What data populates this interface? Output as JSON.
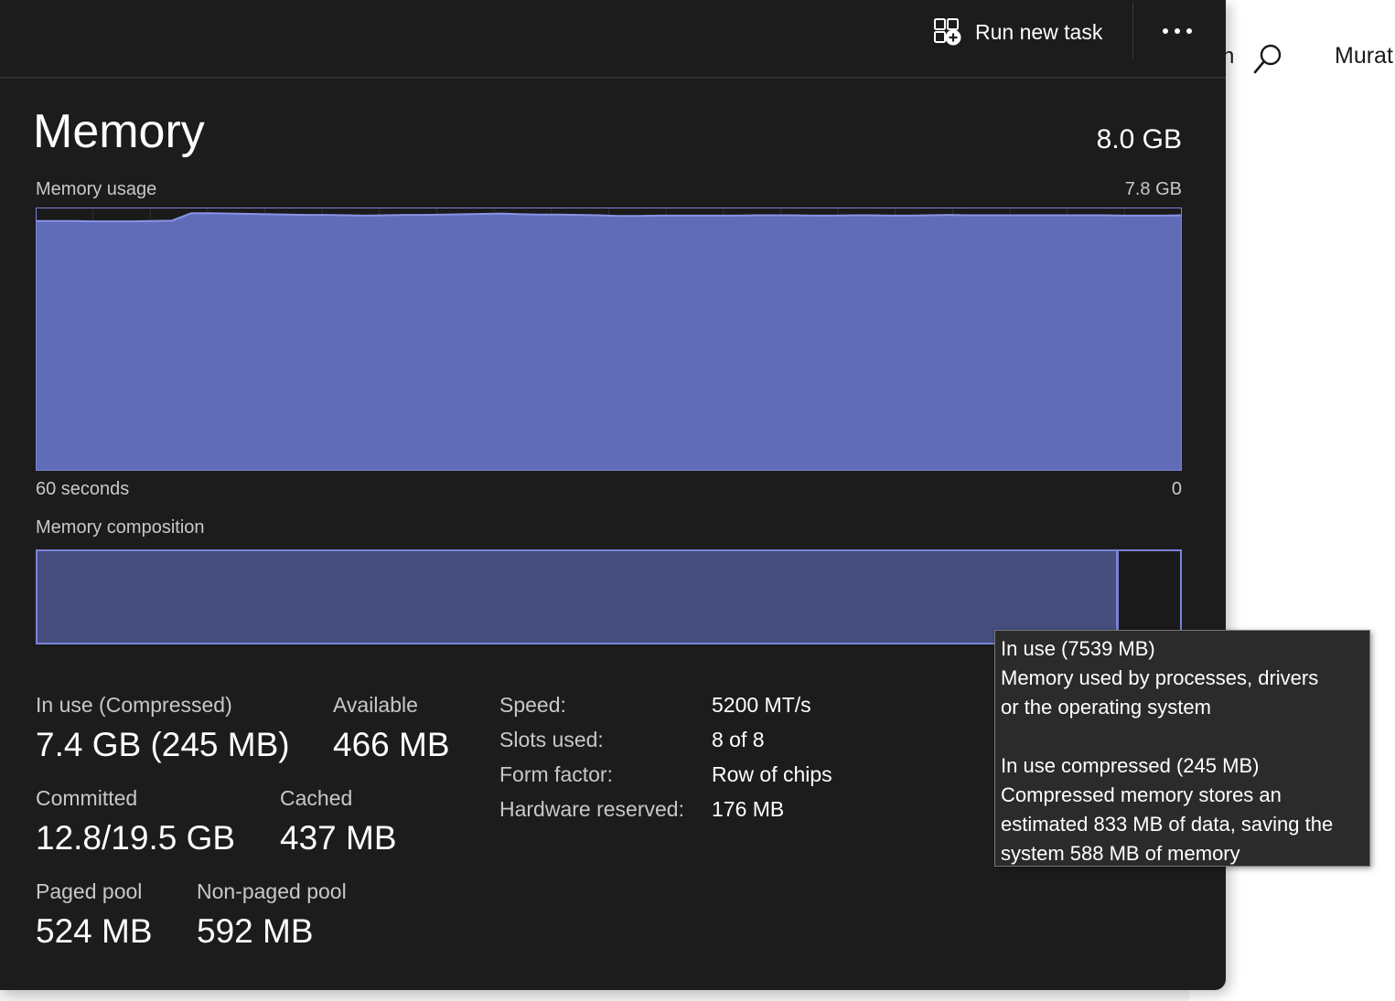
{
  "background_window": {
    "search_fragment": "h",
    "user_fragment": "Murat"
  },
  "toolbar": {
    "run_new_task_label": "Run new task"
  },
  "memory": {
    "title": "Memory",
    "total": "8.0 GB",
    "usage_label": "Memory usage",
    "usage_max": "7.8 GB",
    "axis_left": "60 seconds",
    "axis_right": "0",
    "composition_label": "Memory composition",
    "composition_in_use_fraction": 0.944
  },
  "chart_data": {
    "type": "area",
    "title": "Memory usage",
    "xlabel": "",
    "ylabel": "",
    "x_range_labels": [
      "60 seconds",
      "0"
    ],
    "ylim": [
      0,
      7.8
    ],
    "y_unit": "GB",
    "grid": true,
    "values": [
      7.4,
      7.4,
      7.4,
      7.39,
      7.39,
      7.39,
      7.4,
      7.41,
      7.63,
      7.63,
      7.62,
      7.61,
      7.6,
      7.59,
      7.58,
      7.58,
      7.57,
      7.56,
      7.57,
      7.58,
      7.58,
      7.59,
      7.6,
      7.61,
      7.62,
      7.6,
      7.59,
      7.59,
      7.58,
      7.57,
      7.55,
      7.55,
      7.56,
      7.56,
      7.56,
      7.56,
      7.56,
      7.57,
      7.57,
      7.57,
      7.56,
      7.56,
      7.57,
      7.57,
      7.56,
      7.56,
      7.57,
      7.58,
      7.57,
      7.57,
      7.57,
      7.57,
      7.57,
      7.57,
      7.57,
      7.57,
      7.56,
      7.56,
      7.56,
      7.57
    ]
  },
  "stats": {
    "in_use_label": "In use (Compressed)",
    "in_use_value": "7.4 GB (245 MB)",
    "available_label": "Available",
    "available_value": "466 MB",
    "committed_label": "Committed",
    "committed_value": "12.8/19.5 GB",
    "cached_label": "Cached",
    "cached_value": "437 MB",
    "paged_pool_label": "Paged pool",
    "paged_pool_value": "524 MB",
    "non_paged_pool_label": "Non-paged pool",
    "non_paged_pool_value": "592 MB"
  },
  "specs": {
    "speed_label": "Speed:",
    "speed_value": "5200 MT/s",
    "slots_label": "Slots used:",
    "slots_value": "8 of 8",
    "form_factor_label": "Form factor:",
    "form_factor_value": "Row of chips",
    "hw_reserved_label": "Hardware reserved:",
    "hw_reserved_value": "176 MB"
  },
  "tooltip": {
    "line1": "In use (7539 MB)",
    "line2": "Memory used by processes, drivers",
    "line3": "or the operating system",
    "line4": "In use compressed (245 MB)",
    "line5": "Compressed memory stores an",
    "line6": "estimated 833 MB of data, saving the",
    "line7": "system 588 MB of memory"
  },
  "colors": {
    "chart_fill": "#606cb8",
    "chart_line": "#8a93e6",
    "composition_fill": "#454e7d",
    "accent_border": "#7a83d8"
  }
}
